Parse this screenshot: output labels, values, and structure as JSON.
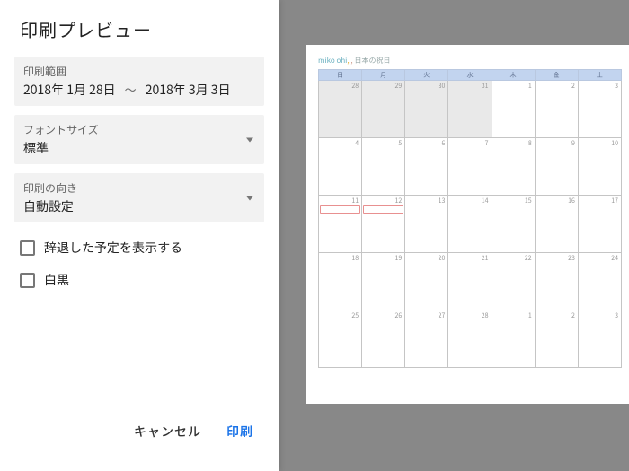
{
  "title": "印刷プレビュー",
  "range": {
    "label": "印刷範囲",
    "start": "2018年 1月 28日",
    "tilde": "〜",
    "end": "2018年 3月 3日"
  },
  "fontSize": {
    "label": "フォントサイズ",
    "value": "標準"
  },
  "orientation": {
    "label": "印刷の向き",
    "value": "自動設定"
  },
  "checkboxes": {
    "declined": "辞退した予定を表示する",
    "bw": "白黒"
  },
  "buttons": {
    "cancel": "キャンセル",
    "print": "印刷"
  },
  "preview": {
    "owner_a": "miko ohi",
    "owner_b": ", ",
    "owner_c": ", ",
    "owner_d": "日本の祝日",
    "dow": [
      "日",
      "月",
      "火",
      "水",
      "木",
      "金",
      "土"
    ],
    "weeks": [
      [
        "28",
        "29",
        "30",
        "31",
        "1",
        "2",
        "3"
      ],
      [
        "4",
        "5",
        "6",
        "7",
        "8",
        "9",
        "10"
      ],
      [
        "11",
        "12",
        "13",
        "14",
        "15",
        "16",
        "17"
      ],
      [
        "18",
        "19",
        "20",
        "21",
        "22",
        "23",
        "24"
      ],
      [
        "25",
        "26",
        "27",
        "28",
        "1",
        "2",
        "3"
      ]
    ],
    "ev_red1": " ",
    "ev_red2": " ",
    "ev_cyan": " "
  }
}
